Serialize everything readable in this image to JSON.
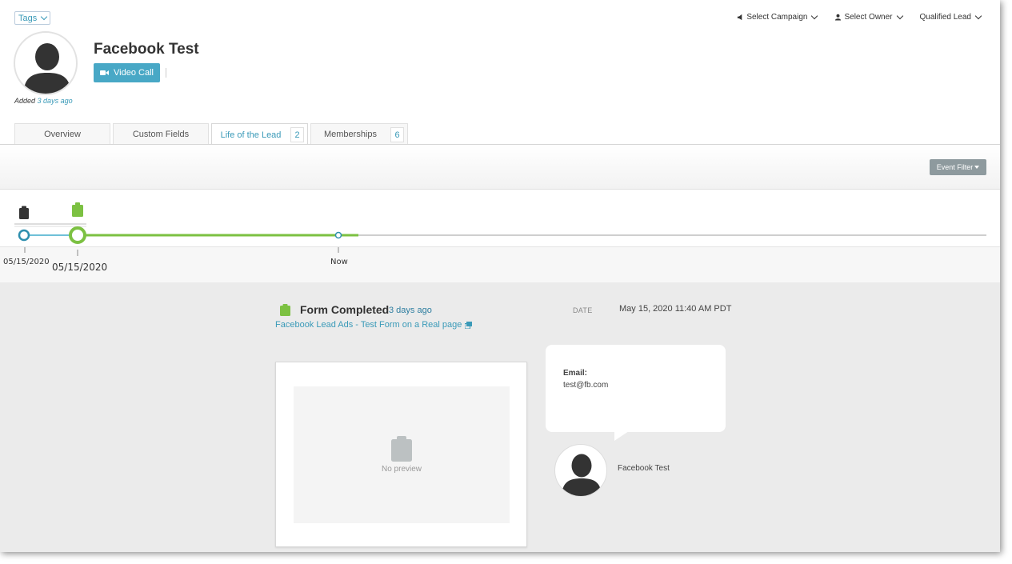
{
  "header": {
    "tags_label": "Tags",
    "select_campaign": "Select Campaign",
    "select_owner": "Select Owner",
    "lead_status": "Qualified Lead",
    "lead_name": "Facebook Test",
    "video_call_label": "Video Call",
    "added_prefix": "Added",
    "added_ago": "3 days ago"
  },
  "tabs": [
    {
      "label": "Overview",
      "badge": null
    },
    {
      "label": "Custom Fields",
      "badge": null
    },
    {
      "label": "Life of the Lead",
      "badge": "2"
    },
    {
      "label": "Memberships",
      "badge": "6"
    }
  ],
  "filter": {
    "event_filter_label": "Event Filter"
  },
  "timeline": {
    "start_date": "05/15/2020",
    "selected_date": "05/15/2020",
    "now_label": "Now"
  },
  "event": {
    "title": "Form Completed",
    "ago": "3 days ago",
    "link_text": "Facebook Lead Ads - Test Form on a Real page",
    "date_label": "DATE",
    "date_value": "May 15, 2020 11:40 AM PDT",
    "no_preview": "No preview",
    "field_label": "Email:",
    "field_value": "test@fb.com",
    "person_name": "Facebook Test"
  },
  "colors": {
    "accent": "#48a8c6",
    "link": "#3a9ab8",
    "green": "#7cc142",
    "dark_icon": "#333333"
  }
}
